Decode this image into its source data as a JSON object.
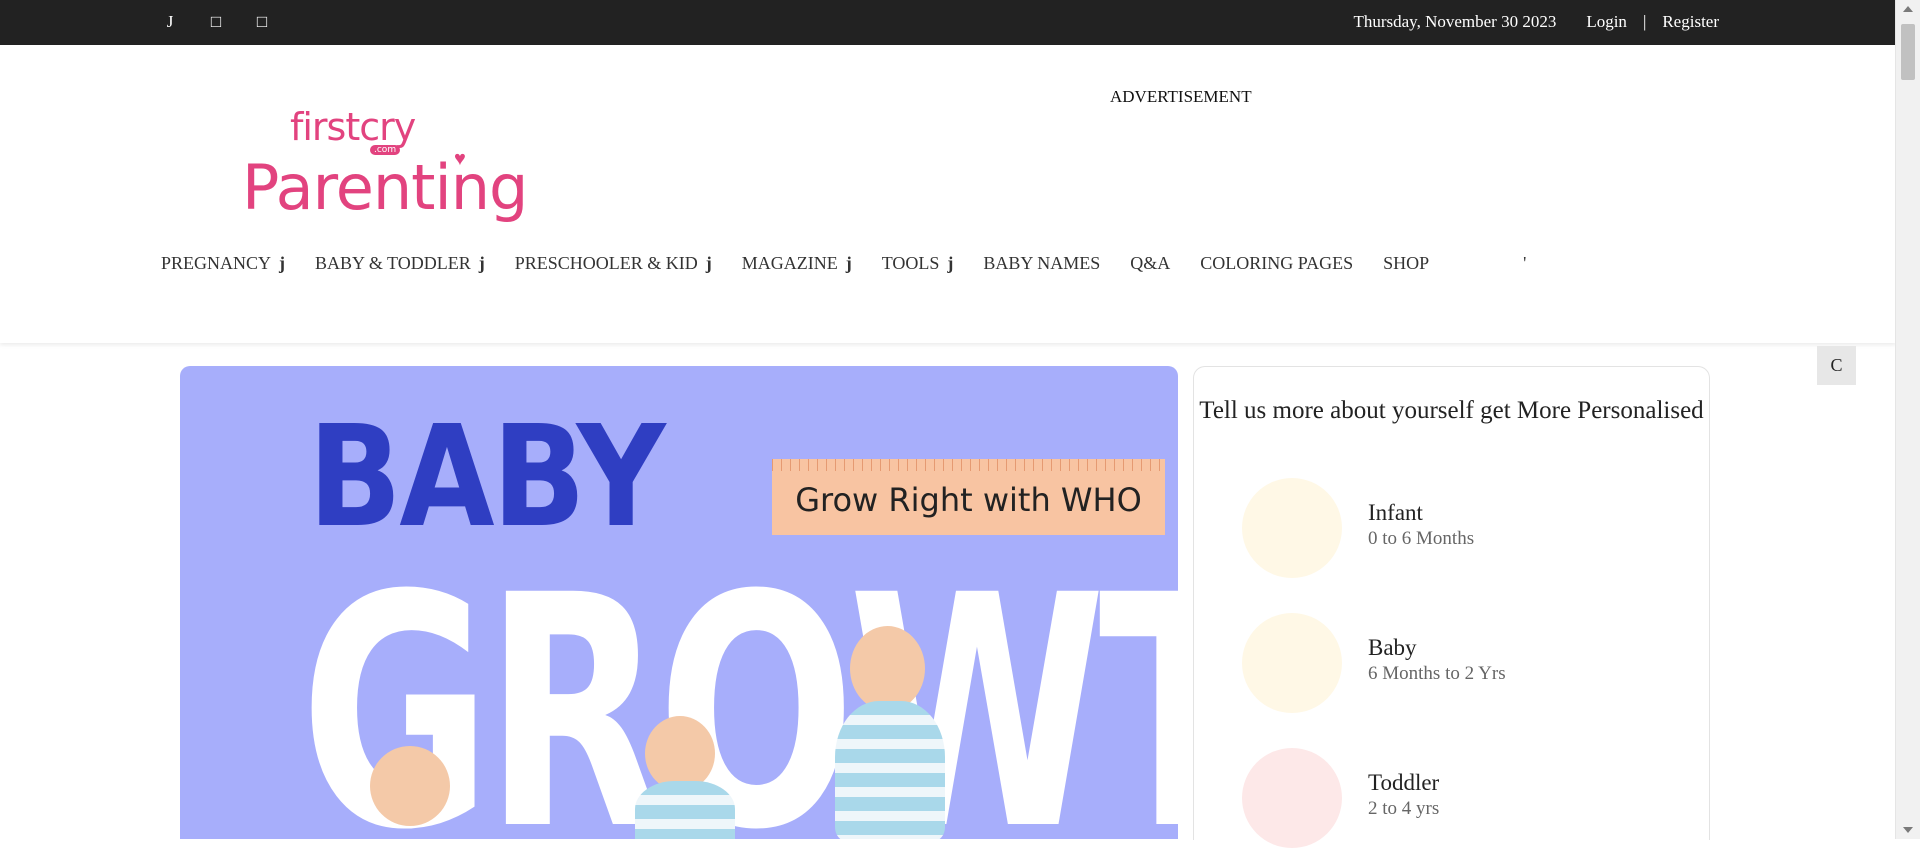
{
  "topbar": {
    "icons": [
      "J",
      "□",
      "□"
    ],
    "date": "Thursday, November 30 2023",
    "login": "Login",
    "separator": "|",
    "register": "Register"
  },
  "header": {
    "logo": {
      "small": "firstcry",
      "com": ".com",
      "big": "Parenting"
    },
    "advertisement": "ADVERTISEMENT"
  },
  "nav": {
    "items": [
      {
        "label": "PREGNANCY",
        "caret": "j"
      },
      {
        "label": "BABY & TODDLER",
        "caret": "j"
      },
      {
        "label": "PRESCHOOLER & KID",
        "caret": "j"
      },
      {
        "label": "MAGAZINE",
        "caret": "j"
      },
      {
        "label": "TOOLS",
        "caret": "j"
      },
      {
        "label": "BABY NAMES",
        "caret": ""
      },
      {
        "label": "Q&A",
        "caret": ""
      },
      {
        "label": "COLORING PAGES",
        "caret": ""
      },
      {
        "label": "SHOP",
        "caret": ""
      }
    ],
    "extra": "'"
  },
  "float_button": "C",
  "hero": {
    "line1": "BABY",
    "line2": "GROWTH",
    "badge": "Grow Right with WHO"
  },
  "card": {
    "title": "Tell us more about yourself get More Personalised",
    "stages": [
      {
        "name": "Infant",
        "range": "0 to 6 Months",
        "color": "#fff8e6"
      },
      {
        "name": "Baby",
        "range": "6 Months to 2 Yrs",
        "color": "#fff8e6"
      },
      {
        "name": "Toddler",
        "range": "2 to 4 yrs",
        "color": "#fde8e8"
      }
    ]
  },
  "colors": {
    "brand": "#e2437f",
    "topbar": "#222222",
    "hero_bg": "#a7aefb"
  }
}
